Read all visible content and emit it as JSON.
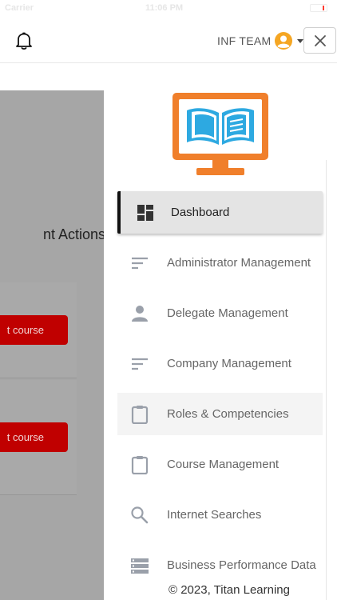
{
  "status_bar": {
    "carrier": "Carrier",
    "time": "11:06 PM"
  },
  "header": {
    "user_label": "INF TEAM",
    "icons": {
      "bell": "bell-icon",
      "avatar": "user-avatar-icon",
      "caret": "caret-down-icon",
      "close": "close-icon"
    }
  },
  "background_page": {
    "heading": "nt Actions",
    "buttons": [
      {
        "label": "t course"
      },
      {
        "label": "t course"
      }
    ]
  },
  "sidebar": {
    "items": [
      {
        "label": "Dashboard",
        "icon": "dashboard-icon",
        "active": true
      },
      {
        "label": "Administrator Management",
        "icon": "sort-lines-icon"
      },
      {
        "label": "Delegate Management",
        "icon": "person-icon"
      },
      {
        "label": "Company Management",
        "icon": "sort-lines-icon"
      },
      {
        "label": "Roles & Competencies",
        "icon": "clipboard-icon",
        "highlighted": true
      },
      {
        "label": "Course Management",
        "icon": "clipboard-icon"
      },
      {
        "label": "Internet Searches",
        "icon": "search-icon"
      },
      {
        "label": "Business Performance Data",
        "icon": "storage-icon"
      }
    ]
  },
  "footer": {
    "copyright": "© 2023, Titan Learning"
  },
  "colors": {
    "logo_orange": "#f07f2b",
    "logo_blue": "#2da9e1",
    "overlay": "#a6a6a6",
    "button_red": "#c00000",
    "active_bg": "#e4e4e4"
  }
}
